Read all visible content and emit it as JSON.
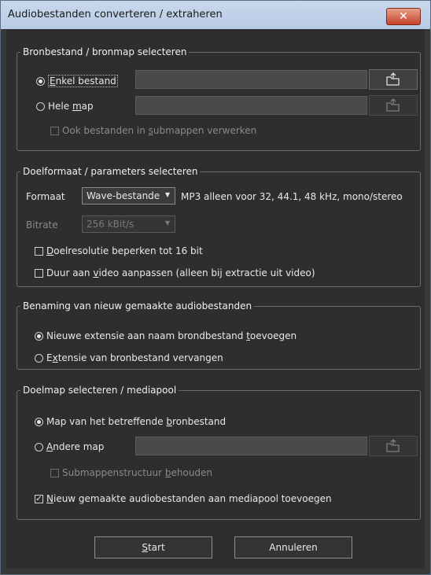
{
  "window": {
    "title": "Audiobestanden converteren / extraheren",
    "close_label": "✕"
  },
  "source": {
    "legend": "Bronbestand / bronmap selecteren",
    "single_file": {
      "pre": "",
      "ul": "E",
      "post": "nkel bestand",
      "selected": true
    },
    "whole_folder": {
      "pre": "Hele ",
      "ul": "m",
      "post": "ap",
      "selected": false
    },
    "subfolders": {
      "pre": "Ook bestanden in ",
      "ul": "s",
      "post": "ubmappen verwerken",
      "checked": false,
      "enabled": false
    },
    "single_file_path": "",
    "folder_path": ""
  },
  "target": {
    "legend": "Doelformaat / parameters selecteren",
    "format_label": "Formaat",
    "format_value": "Wave-bestande",
    "format_note": "MP3 alleen voor 32, 44.1, 48 kHz, mono/stereo",
    "bitrate_label": "Bitrate",
    "bitrate_value": "256 kBit/s",
    "limit16": {
      "pre": "",
      "ul": "D",
      "post": "oelresolutie beperken tot 16 bit",
      "checked": false
    },
    "match_video": {
      "pre": "Duur aan ",
      "ul": "v",
      "post": "ideo aanpassen (alleen bij extractie uit video)",
      "checked": false
    }
  },
  "naming": {
    "legend": "Benaming van nieuw gemaakte audiobestanden",
    "append_ext": {
      "pre": "Nieuwe extensie aan naam brondbestand ",
      "ul": "t",
      "post": "oevoegen",
      "selected": true
    },
    "replace_ext": {
      "pre": "E",
      "ul": "x",
      "post": "tensie van bronbestand vervangen",
      "selected": false
    }
  },
  "destination": {
    "legend": "Doelmap selecteren / mediapool",
    "source_folder": {
      "pre": "Map van het betreffende ",
      "ul": "b",
      "post": "ronbestand",
      "selected": true
    },
    "other_folder": {
      "pre": "",
      "ul": "A",
      "post": "ndere map",
      "selected": false
    },
    "keep_structure": {
      "pre": "Submappenstructuur ",
      "ul": "b",
      "post": "ehouden",
      "checked": false,
      "enabled": false
    },
    "add_mediapool": {
      "pre": "",
      "ul": "N",
      "post": "ieuw gemaakte audiobestanden aan mediapool toevoegen",
      "checked": true
    },
    "other_folder_path": ""
  },
  "buttons": {
    "start": {
      "pre": "",
      "ul": "S",
      "post": "tart"
    },
    "cancel": "Annuleren"
  },
  "icons": {
    "folder": "open-folder-icon",
    "close": "close-icon",
    "dropdown": "chevron-down-icon"
  },
  "colors": {
    "title_bar": "#c3d5ea",
    "close_button": "#c7432a",
    "background": "#2e2e2e"
  }
}
